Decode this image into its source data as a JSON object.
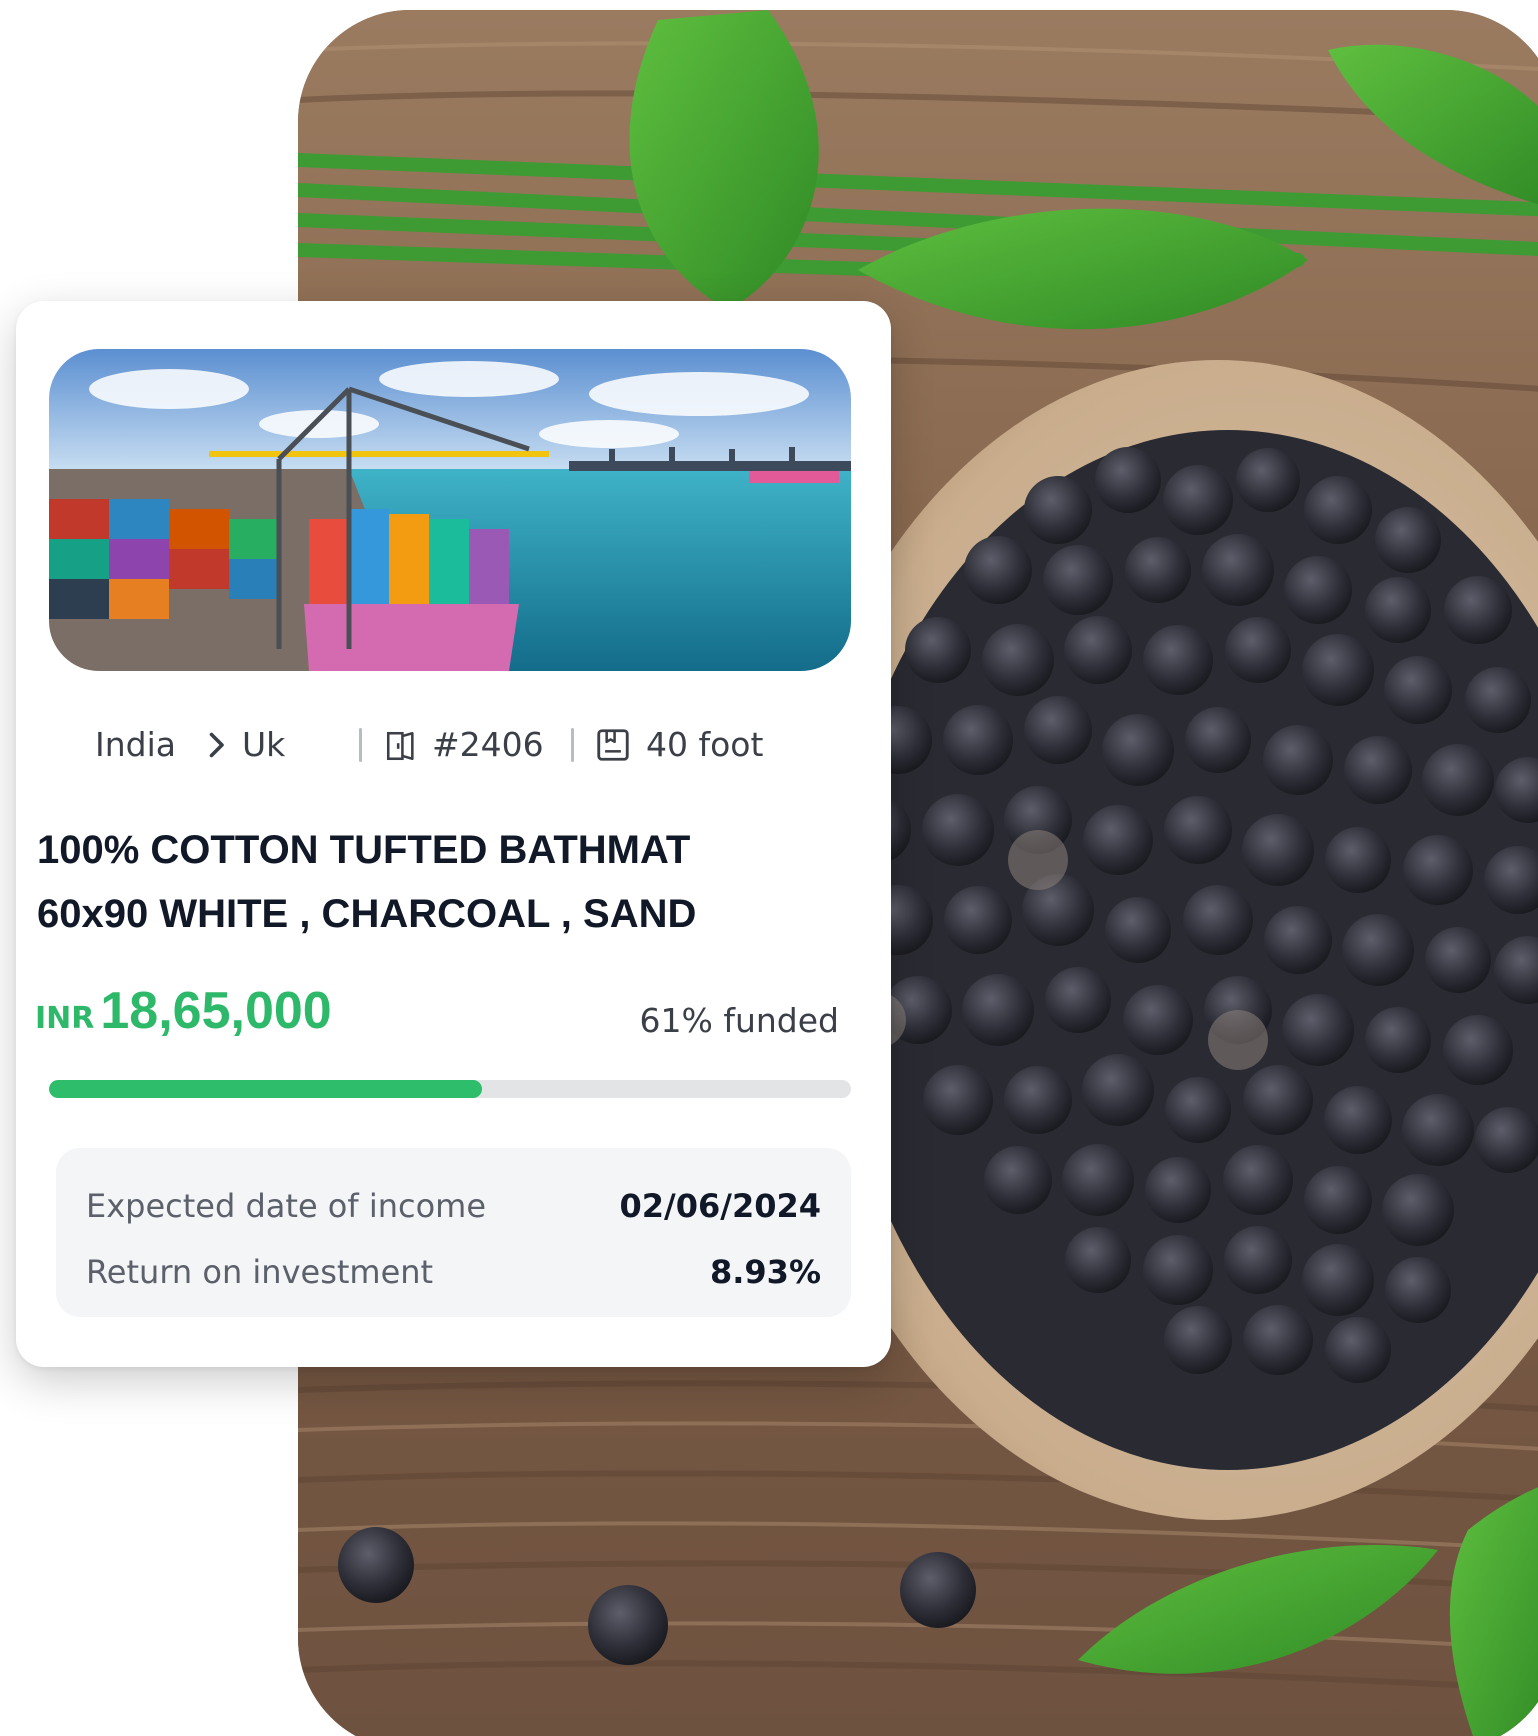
{
  "card": {
    "origin": "India",
    "destination": "Uk",
    "container_id": "#2406",
    "container_size": "40 foot",
    "title_line1": "100% COTTON TUFTED BATHMAT",
    "title_line2": "60x90 WHITE , CHARCOAL , SAND",
    "currency": "INR",
    "amount": "18,65,000",
    "funded_label": "61% funded",
    "funded_percent": 54,
    "expected_income_label": "Expected date of income",
    "expected_income_value": "02/06/2024",
    "roi_label": "Return on investment",
    "roi_value": "8.93%"
  },
  "icons": {
    "route": "chevron-right-icon",
    "container": "container-door-icon",
    "size": "cargo-box-icon"
  },
  "colors": {
    "accent_green": "#2eb86a",
    "progress_track": "#e3e4e6",
    "title_text": "#111827",
    "muted_text": "#5b606b",
    "info_box_bg": "#f4f5f7"
  }
}
